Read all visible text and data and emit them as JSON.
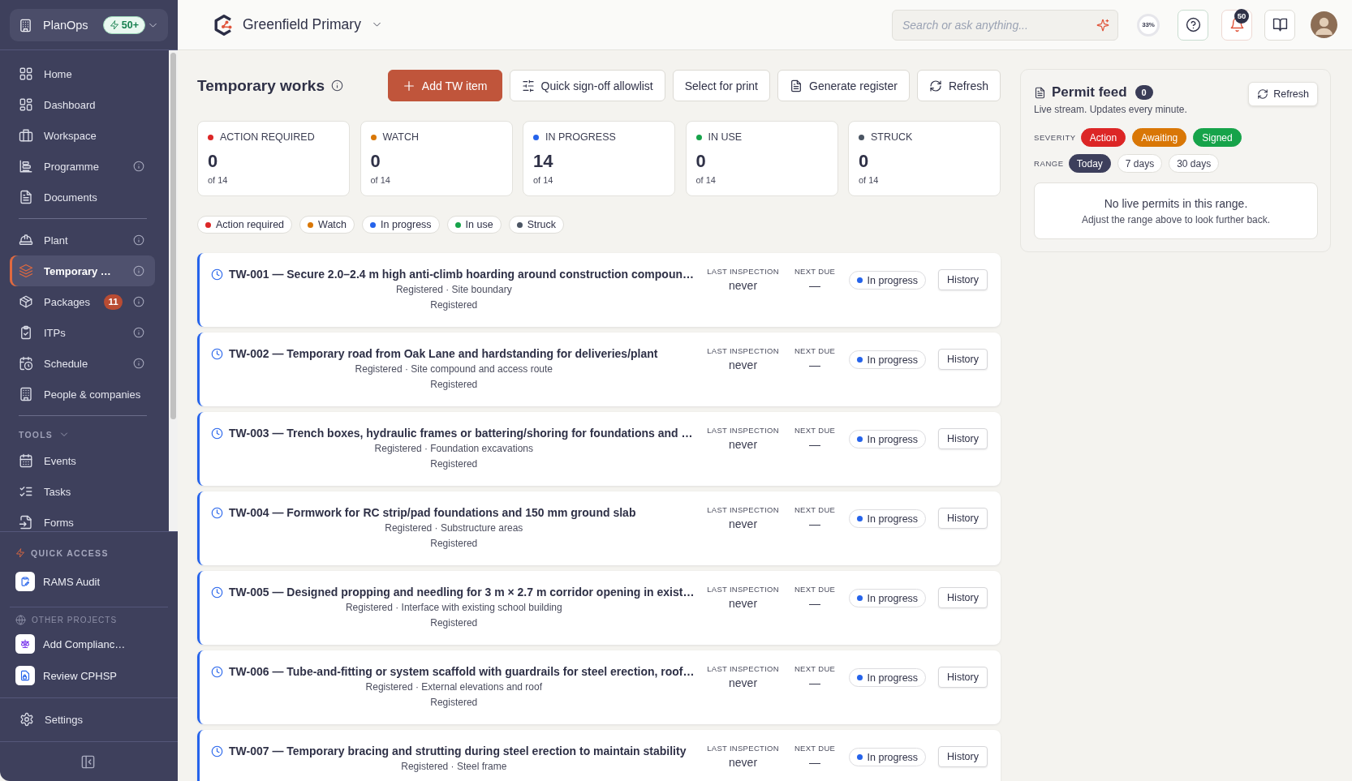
{
  "sidebar": {
    "workspace": {
      "name": "PlanOps",
      "badge": "50+"
    },
    "nav_groups": [
      {
        "items": [
          {
            "label": "Home",
            "info": false,
            "selected": false
          },
          {
            "label": "Dashboard",
            "info": false,
            "selected": false
          },
          {
            "label": "Workspace",
            "info": false,
            "selected": false
          },
          {
            "label": "Programme",
            "info": true,
            "selected": false
          },
          {
            "label": "Documents",
            "info": false,
            "selected": false
          }
        ]
      },
      {
        "items": [
          {
            "label": "Plant",
            "info": true,
            "selected": false
          },
          {
            "label": "Temporary …",
            "info": true,
            "selected": true
          },
          {
            "label": "Packages",
            "info": true,
            "selected": false,
            "badge": "11"
          },
          {
            "label": "ITPs",
            "info": true,
            "selected": false
          },
          {
            "label": "Schedule",
            "info": true,
            "selected": false
          },
          {
            "label": "People & companies",
            "info": false,
            "selected": false
          }
        ]
      }
    ],
    "tools": {
      "title": "TOOLS",
      "expanded": true,
      "items": [
        {
          "label": "Events",
          "selected": false
        },
        {
          "label": "Tasks",
          "selected": false
        },
        {
          "label": "Forms",
          "selected": false
        }
      ]
    },
    "quick_access": {
      "title": "QUICK ACCESS",
      "items": [
        {
          "label": "RAMS Audit"
        }
      ]
    },
    "other_projects": {
      "title": "OTHER PROJECTS",
      "items": [
        {
          "label": "Add Complianc…"
        },
        {
          "label": "Review CPHSP"
        }
      ]
    },
    "settings": {
      "label": "Settings"
    }
  },
  "header": {
    "project": "Greenfield Primary",
    "search": {
      "placeholder": "Search or ask anything..."
    },
    "completion": "33%",
    "notifications": "50"
  },
  "page": {
    "title": "Temporary works",
    "actions": [
      {
        "label": "Add TW item",
        "kind": "primary"
      },
      {
        "label": "Quick sign-off allowlist",
        "kind": "default"
      },
      {
        "label": "Select for print",
        "kind": "default"
      },
      {
        "label": "Generate register",
        "kind": "default"
      },
      {
        "label": "Refresh",
        "kind": "default"
      }
    ]
  },
  "summary": [
    {
      "label": "ACTION REQUIRED",
      "value": "0",
      "total": "of 14",
      "color": "#dc2626"
    },
    {
      "label": "WATCH",
      "value": "0",
      "total": "of 14",
      "color": "#d97706"
    },
    {
      "label": "IN PROGRESS",
      "value": "14",
      "total": "of 14",
      "color": "#2563eb"
    },
    {
      "label": "IN USE",
      "value": "0",
      "total": "of 14",
      "color": "#16a34a"
    },
    {
      "label": "STRUCK",
      "value": "0",
      "total": "of 14",
      "color": "#4b5563"
    }
  ],
  "filters": [
    {
      "label": "Action required",
      "color": "#dc2626"
    },
    {
      "label": "Watch",
      "color": "#d97706"
    },
    {
      "label": "In progress",
      "color": "#2563eb"
    },
    {
      "label": "In use",
      "color": "#16a34a"
    },
    {
      "label": "Struck",
      "color": "#4b5563"
    }
  ],
  "items": [
    {
      "title": "TW-001 — Secure 2.0–2.4 m high anti-climb hoarding around construction compoun…",
      "meta": "Registered · Site boundary",
      "state": "Registered",
      "last_inspection_label": "LAST INSPECTION",
      "last_inspection": "never",
      "next_due_label": "NEXT DUE",
      "next_due": "—",
      "status": {
        "label": "In progress",
        "color": "#2563eb"
      },
      "action": "History"
    },
    {
      "title": "TW-002 — Temporary road from Oak Lane and hardstanding for deliveries/plant",
      "meta": "Registered · Site compound and access route",
      "state": "Registered",
      "last_inspection_label": "LAST INSPECTION",
      "last_inspection": "never",
      "next_due_label": "NEXT DUE",
      "next_due": "—",
      "status": {
        "label": "In progress",
        "color": "#2563eb"
      },
      "action": "History"
    },
    {
      "title": "TW-003 — Trench boxes, hydraulic frames or battering/shoring for foundations and …",
      "meta": "Registered · Foundation excavations",
      "state": "Registered",
      "last_inspection_label": "LAST INSPECTION",
      "last_inspection": "never",
      "next_due_label": "NEXT DUE",
      "next_due": "—",
      "status": {
        "label": "In progress",
        "color": "#2563eb"
      },
      "action": "History"
    },
    {
      "title": "TW-004 — Formwork for RC strip/pad foundations and 150 mm ground slab",
      "meta": "Registered · Substructure areas",
      "state": "Registered",
      "last_inspection_label": "LAST INSPECTION",
      "last_inspection": "never",
      "next_due_label": "NEXT DUE",
      "next_due": "—",
      "status": {
        "label": "In progress",
        "color": "#2563eb"
      },
      "action": "History"
    },
    {
      "title": "TW-005 — Designed propping and needling for 3 m × 2.7 m corridor opening in exist…",
      "meta": "Registered · Interface with existing school building",
      "state": "Registered",
      "last_inspection_label": "LAST INSPECTION",
      "last_inspection": "never",
      "next_due_label": "NEXT DUE",
      "next_due": "—",
      "status": {
        "label": "In progress",
        "color": "#2563eb"
      },
      "action": "History"
    },
    {
      "title": "TW-006 — Tube-and-fitting or system scaffold with guardrails for steel erection, roof…",
      "meta": "Registered · External elevations and roof",
      "state": "Registered",
      "last_inspection_label": "LAST INSPECTION",
      "last_inspection": "never",
      "next_due_label": "NEXT DUE",
      "next_due": "—",
      "status": {
        "label": "In progress",
        "color": "#2563eb"
      },
      "action": "History"
    },
    {
      "title": "TW-007 — Temporary bracing and strutting during steel erection to maintain stability",
      "meta": "Registered · Steel frame",
      "last_inspection_label": "LAST INSPECTION",
      "last_inspection": "never",
      "next_due_label": "NEXT DUE",
      "next_due": "—",
      "status": {
        "label": "In progress",
        "color": "#2563eb"
      },
      "action": "History"
    }
  ],
  "permit_feed": {
    "title": "Permit feed",
    "count": "0",
    "refresh": "Refresh",
    "subtitle": "Live stream. Updates every minute.",
    "severity_label": "SEVERITY",
    "severity": [
      {
        "label": "Action",
        "color": "#dc2626",
        "on": true
      },
      {
        "label": "Awaiting",
        "color": "#d97706",
        "on": true
      },
      {
        "label": "Signed",
        "color": "#16a34a",
        "on": true
      }
    ],
    "range_label": "RANGE",
    "range": [
      {
        "label": "Today",
        "selected": true
      },
      {
        "label": "7 days",
        "selected": false
      },
      {
        "label": "30 days",
        "selected": false
      }
    ],
    "empty": {
      "title": "No live permits in this range.",
      "hint": "Adjust the range above to look further back."
    }
  }
}
